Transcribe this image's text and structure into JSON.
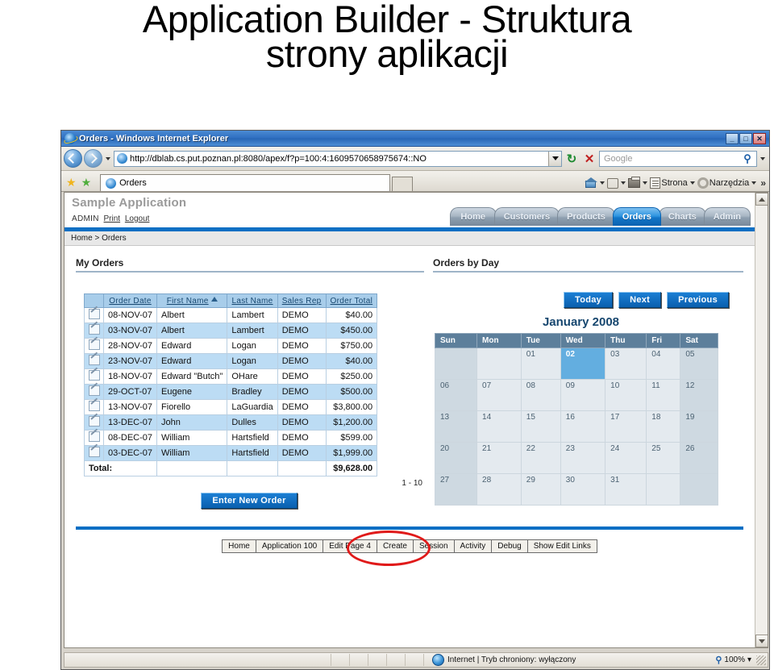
{
  "slide": {
    "title_line1": "Application Builder - Struktura",
    "title_line2": "strony aplikacji"
  },
  "browser": {
    "window_title": "Orders - Windows Internet Explorer",
    "minimize_label": "_",
    "maximize_label": "□",
    "close_label": "✕",
    "url": "http://dblab.cs.put.poznan.pl:8080/apex/f?p=100:4:1609570658975674::NO",
    "refresh_label": "↻",
    "stop_label": "✕",
    "search_placeholder": "Google",
    "search_value": "",
    "search_icon_label": "⚲",
    "tab_label": "Orders",
    "toolbar_right": {
      "page_label": "Strona",
      "tools_label": "Narzędzia",
      "overflow_label": "»"
    }
  },
  "status_bar": {
    "zone_text": "Internet | Tryb chroniony: wyłączony",
    "zoom_label": "100%",
    "zoom_caret": "▾",
    "zoom_icon_label": "⚲"
  },
  "app": {
    "name": "Sample Application",
    "user": "ADMIN",
    "print_label": "Print",
    "logout_label": "Logout",
    "breadcrumb": "Home > Orders",
    "tabs": [
      {
        "label": "Home",
        "active": false
      },
      {
        "label": "Customers",
        "active": false
      },
      {
        "label": "Products",
        "active": false
      },
      {
        "label": "Orders",
        "active": true
      },
      {
        "label": "Charts",
        "active": false
      },
      {
        "label": "Admin",
        "active": false
      }
    ]
  },
  "orders_region": {
    "title": "My Orders",
    "columns": [
      "",
      "Order Date",
      "First Name",
      "Last Name",
      "Sales Rep",
      "Order Total"
    ],
    "sorted_column": "First Name",
    "sort_direction": "asc",
    "rows": [
      {
        "date": "08-NOV-07",
        "first": "Albert",
        "last": "Lambert",
        "rep": "DEMO",
        "total": "$40.00"
      },
      {
        "date": "03-NOV-07",
        "first": "Albert",
        "last": "Lambert",
        "rep": "DEMO",
        "total": "$450.00"
      },
      {
        "date": "28-NOV-07",
        "first": "Edward",
        "last": "Logan",
        "rep": "DEMO",
        "total": "$750.00"
      },
      {
        "date": "23-NOV-07",
        "first": "Edward",
        "last": "Logan",
        "rep": "DEMO",
        "total": "$40.00"
      },
      {
        "date": "18-NOV-07",
        "first": "Edward \"Butch\"",
        "last": "OHare",
        "rep": "DEMO",
        "total": "$250.00"
      },
      {
        "date": "29-OCT-07",
        "first": "Eugene",
        "last": "Bradley",
        "rep": "DEMO",
        "total": "$500.00"
      },
      {
        "date": "13-NOV-07",
        "first": "Fiorello",
        "last": "LaGuardia",
        "rep": "DEMO",
        "total": "$3,800.00"
      },
      {
        "date": "13-DEC-07",
        "first": "John",
        "last": "Dulles",
        "rep": "DEMO",
        "total": "$1,200.00"
      },
      {
        "date": "08-DEC-07",
        "first": "William",
        "last": "Hartsfield",
        "rep": "DEMO",
        "total": "$599.00"
      },
      {
        "date": "03-DEC-07",
        "first": "William",
        "last": "Hartsfield",
        "rep": "DEMO",
        "total": "$1,999.00"
      }
    ],
    "total_label": "Total:",
    "total_value": "$9,628.00",
    "pagination": "1 - 10",
    "new_order_button": "Enter New Order"
  },
  "calendar_region": {
    "title": "Orders by Day",
    "buttons": [
      "Today",
      "Next",
      "Previous"
    ],
    "month_title": "January 2008",
    "day_headers": [
      "Sun",
      "Mon",
      "Tue",
      "Wed",
      "Thu",
      "Fri",
      "Sat"
    ],
    "weeks": [
      [
        {
          "d": "",
          "we": true
        },
        {
          "d": ""
        },
        {
          "d": "01"
        },
        {
          "d": "02",
          "today": true
        },
        {
          "d": "03"
        },
        {
          "d": "04"
        },
        {
          "d": "05",
          "we": true
        }
      ],
      [
        {
          "d": "06",
          "we": true
        },
        {
          "d": "07"
        },
        {
          "d": "08"
        },
        {
          "d": "09"
        },
        {
          "d": "10"
        },
        {
          "d": "11"
        },
        {
          "d": "12",
          "we": true
        }
      ],
      [
        {
          "d": "13",
          "we": true
        },
        {
          "d": "14"
        },
        {
          "d": "15"
        },
        {
          "d": "16"
        },
        {
          "d": "17"
        },
        {
          "d": "18"
        },
        {
          "d": "19",
          "we": true
        }
      ],
      [
        {
          "d": "20",
          "we": true
        },
        {
          "d": "21"
        },
        {
          "d": "22"
        },
        {
          "d": "23"
        },
        {
          "d": "24"
        },
        {
          "d": "25"
        },
        {
          "d": "26",
          "we": true
        }
      ],
      [
        {
          "d": "27",
          "we": true
        },
        {
          "d": "28"
        },
        {
          "d": "29"
        },
        {
          "d": "30"
        },
        {
          "d": "31"
        },
        {
          "d": ""
        },
        {
          "d": "",
          "we": true
        }
      ]
    ]
  },
  "developer_toolbar": {
    "items": [
      "Home",
      "Application 100",
      "Edit Page 4",
      "Create",
      "Session",
      "Activity",
      "Debug",
      "Show Edit Links"
    ],
    "highlighted_item": "Edit Page 4"
  },
  "colors": {
    "accent_blue": "#0b6fc4",
    "tab_active": "#1276c8",
    "table_header": "#a8cdea",
    "table_alt_row": "#bcdcf4",
    "calendar_header": "#5d7f9b",
    "calendar_today": "#63aee0",
    "highlight_red": "#e01a1a"
  }
}
